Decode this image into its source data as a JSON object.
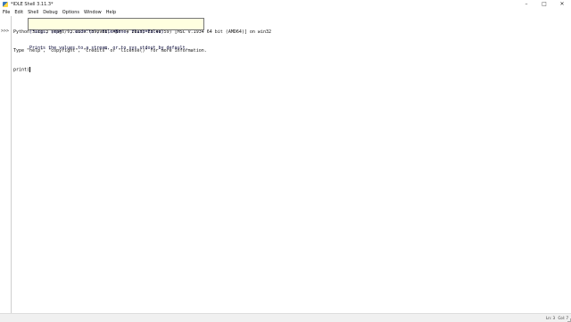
{
  "window": {
    "title": "*IDLE Shell 3.11.3*",
    "controls": {
      "minimize": "–",
      "maximize": "□",
      "close": "✕"
    }
  },
  "menu": {
    "items": [
      "File",
      "Edit",
      "Shell",
      "Debug",
      "Options",
      "Window",
      "Help"
    ]
  },
  "shell": {
    "prompt": ">>>",
    "banner_line1": "Python 3.11.3 (tags/v3.11.3:f3909b8, Apr  4 2023, 23:49:59) [MSC v.1934 64 bit (AMD64)] on win32",
    "banner_line2": "Type \"help\", \"copyright\", \"credits\" or \"license()\" for more information.",
    "input_line": "print("
  },
  "calltip": {
    "signature": "(*args, sep=' ', end='\\n', file=None, flush=False)",
    "description": "Prints the values to a stream, or to sys.stdout by default."
  },
  "status": {
    "line": "Ln: 3",
    "column": "Col: 7"
  },
  "icons": {
    "app": "python-idle-icon"
  },
  "colors": {
    "calltip_background": "#ffffe0",
    "background": "#ffffff"
  }
}
